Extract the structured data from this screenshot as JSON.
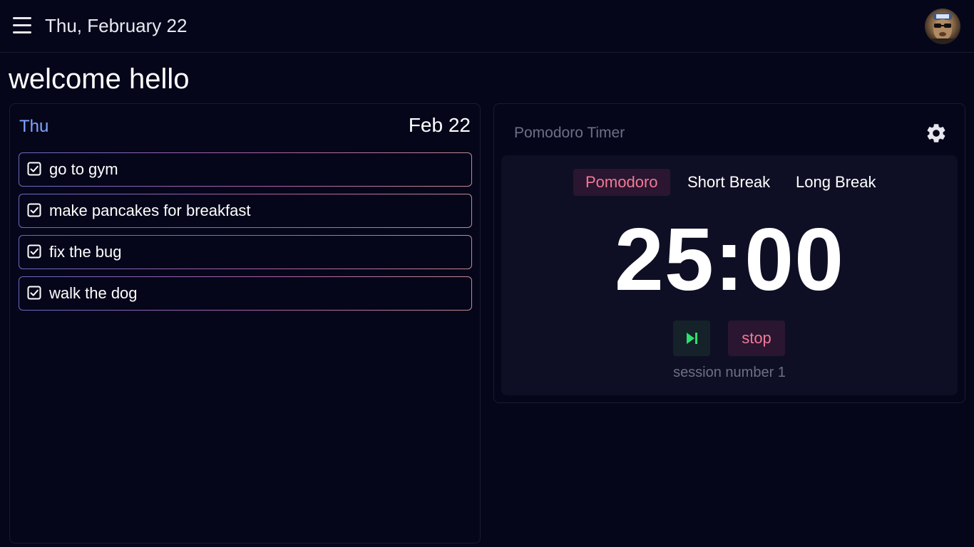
{
  "header": {
    "date": "Thu, February 22",
    "menu_icon": "hamburger-menu-icon",
    "avatar_icon": "user-avatar"
  },
  "welcome": "welcome hello",
  "todo": {
    "day": "Thu",
    "date": "Feb 22",
    "items": [
      {
        "label": "go to gym",
        "icon": "checkbox-checked-icon"
      },
      {
        "label": "make pancakes for breakfast",
        "icon": "checkbox-checked-icon"
      },
      {
        "label": "fix the bug",
        "icon": "checkbox-checked-icon"
      },
      {
        "label": "walk the dog",
        "icon": "checkbox-checked-icon"
      }
    ]
  },
  "timer": {
    "title": "Pomodoro Timer",
    "settings_icon": "gear-icon",
    "modes": [
      "Pomodoro",
      "Short Break",
      "Long Break"
    ],
    "active_mode": "Pomodoro",
    "time": "25:00",
    "skip_icon": "skip-next-icon",
    "stop_label": "stop",
    "session": "session number 1"
  },
  "colors": {
    "background": "#05061a",
    "accent_blue": "#7fa6ff",
    "accent_pink": "#f27a97",
    "accent_green": "#2ee06a",
    "muted_text": "#6c6f85"
  }
}
